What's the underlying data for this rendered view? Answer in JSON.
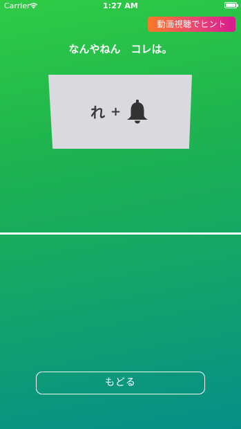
{
  "status_bar": {
    "carrier": "Carrier",
    "time": "1:27 AM"
  },
  "hint_button": {
    "label": "動画視聴でヒント"
  },
  "question": {
    "title": "なんやねん　コレは。"
  },
  "puzzle": {
    "character": "れ",
    "operator": "+",
    "icon": "bell-icon"
  },
  "back_button": {
    "label": "もどる"
  },
  "colors": {
    "background_top": "#2fcb45",
    "background_bottom": "#078e88",
    "hint_gradient_start": "#f77a28",
    "hint_gradient_end": "#d81b8f",
    "card": "#d9d9df"
  }
}
